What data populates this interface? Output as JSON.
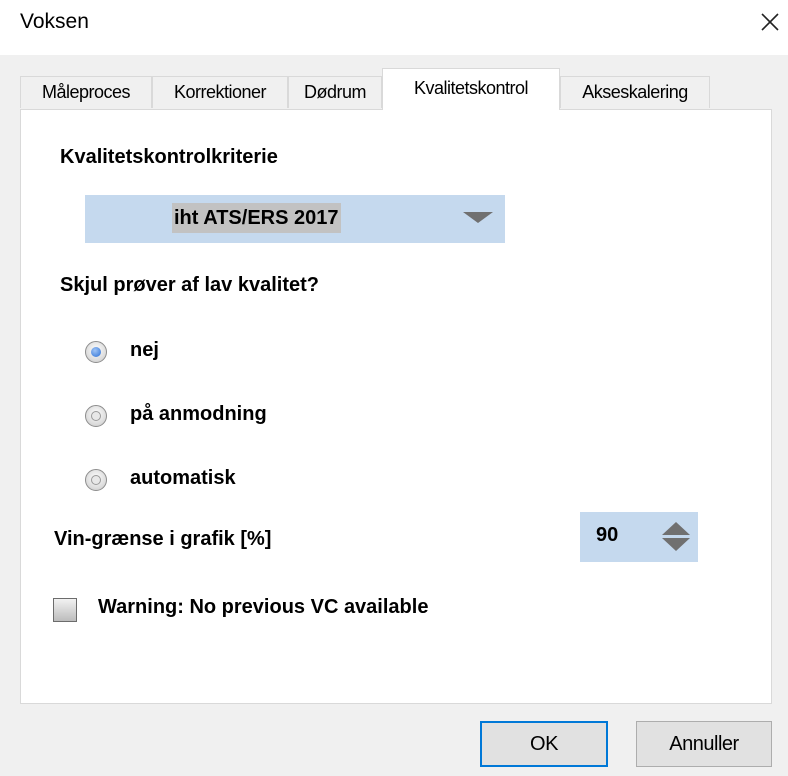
{
  "window": {
    "title": "Voksen",
    "close_icon": "close-icon"
  },
  "tabs": [
    {
      "label": "Måleproces",
      "active": false
    },
    {
      "label": "Korrektioner",
      "active": false
    },
    {
      "label": "Dødrum",
      "active": false
    },
    {
      "label": "Kvalitetskontrol",
      "active": true
    },
    {
      "label": "Akseskalering",
      "active": false
    }
  ],
  "quality": {
    "criteria_label": "Kvalitetskontrolkriterie",
    "criteria_value": "iht ATS/ERS 2017",
    "hide_label": "Skjul prøver af lav kvalitet?",
    "options": [
      {
        "label": "nej",
        "selected": true
      },
      {
        "label": "på anmodning",
        "selected": false
      },
      {
        "label": "automatisk",
        "selected": false
      }
    ],
    "vin_label": "Vin-grænse i grafik [%]",
    "vin_value": "90",
    "warning_label": "Warning: No previous VC available",
    "warning_checked": false
  },
  "buttons": {
    "ok": "OK",
    "cancel": "Annuller"
  },
  "colors": {
    "field_bg": "#c5d9ee",
    "radio_selected": "#2a6fd6",
    "ok_border": "#0078d7"
  }
}
